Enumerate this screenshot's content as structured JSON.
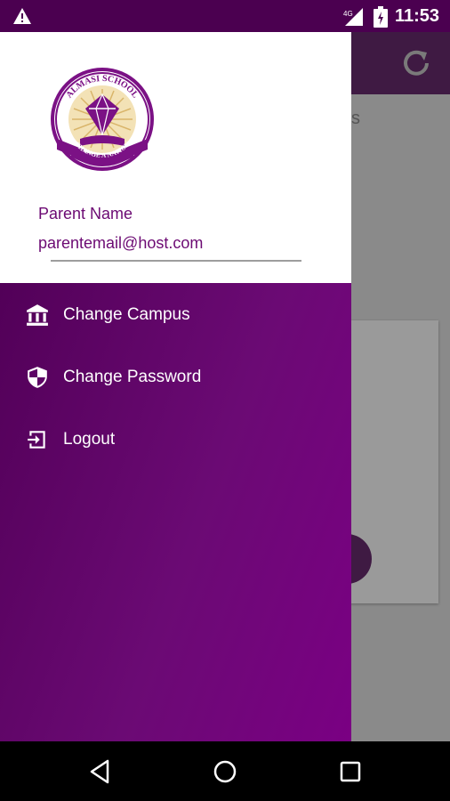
{
  "status_bar": {
    "time": "11:53"
  },
  "background_app": {
    "partial_text": "s"
  },
  "drawer": {
    "school_name": "ALMASI SCHOOL",
    "school_motto": "CHANGE A NATION",
    "parent_name": "Parent Name",
    "parent_email": "parentemail@host.com",
    "menu": [
      {
        "label": "Change Campus",
        "icon": "bank-icon"
      },
      {
        "label": "Change Password",
        "icon": "shield-icon"
      },
      {
        "label": "Logout",
        "icon": "logout-icon"
      }
    ]
  },
  "colors": {
    "primary": "#6c0a73",
    "status_bar": "#4b0050",
    "drawer_gradient_start": "#520058",
    "drawer_gradient_end": "#7a0083"
  }
}
